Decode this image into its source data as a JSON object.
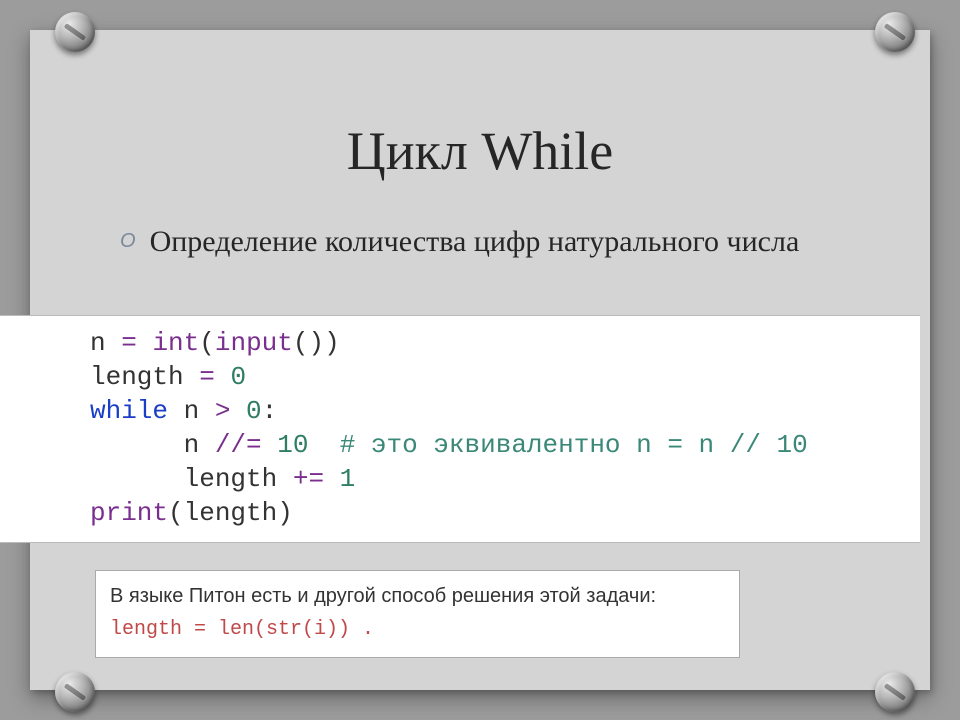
{
  "title": "Цикл While",
  "subtitle": "Определение количества цифр натурального числа",
  "bullet": "O",
  "code1": {
    "l1a": "n ",
    "l1b": "= ",
    "l1c": "int",
    "l1d": "(",
    "l1e": "input",
    "l1f": "())",
    "l2a": "length ",
    "l2b": "= ",
    "l2c": "0",
    "l3a": "while",
    "l3b": " n ",
    "l3c": ">",
    "l3d": " ",
    "l3e": "0",
    "l3f": ":",
    "l4a": "      n ",
    "l4b": "//= ",
    "l4c": "10",
    "l4d": "  ",
    "l4e": "# это эквивалентно n = n // 10",
    "l5a": "      length ",
    "l5b": "+= ",
    "l5c": "1",
    "l6a": "print",
    "l6b": "(length)"
  },
  "code2": {
    "desc": "В языке Питон есть и другой способ решения этой задачи:",
    "line": "length = len(str(i)) ."
  }
}
